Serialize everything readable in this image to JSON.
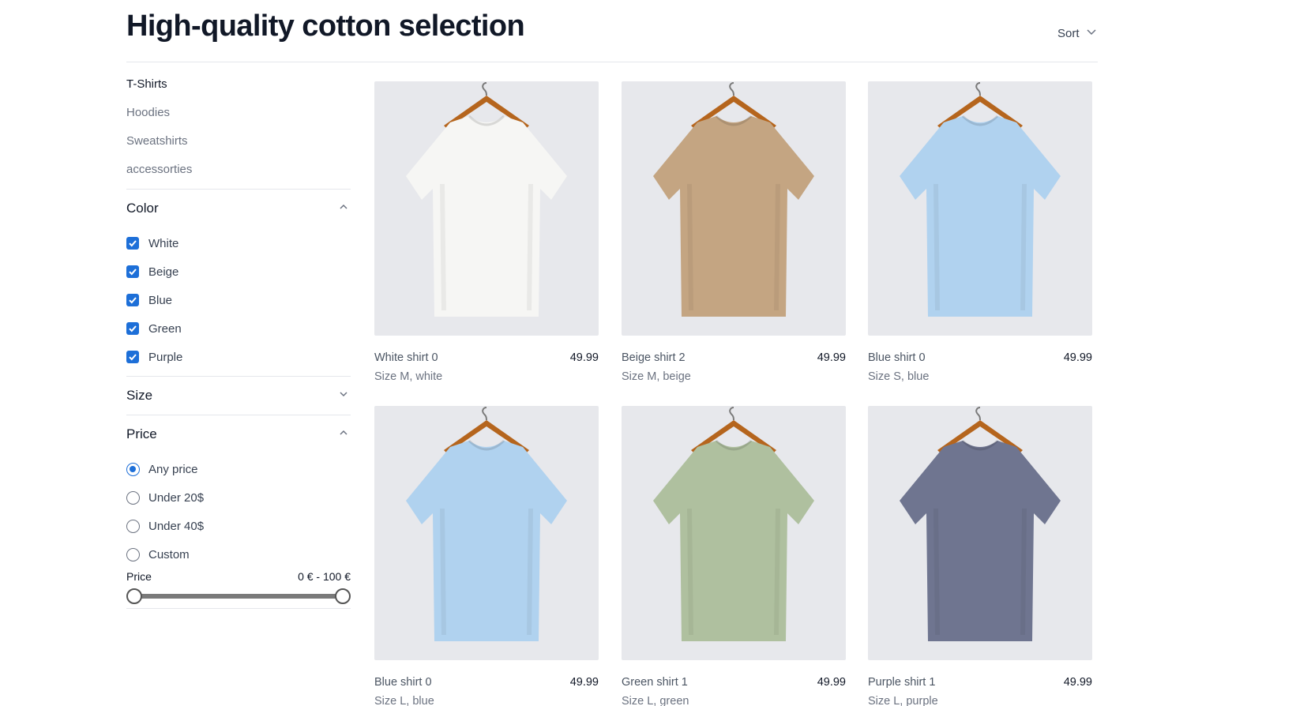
{
  "header": {
    "title": "High-quality cotton selection",
    "sort_label": "Sort"
  },
  "sidebar": {
    "categories": [
      {
        "label": "T-Shirts"
      },
      {
        "label": "Hoodies"
      },
      {
        "label": "Sweatshirts"
      },
      {
        "label": "accessorties"
      }
    ],
    "color_filter": {
      "title": "Color",
      "options": [
        {
          "label": "White",
          "checked": true
        },
        {
          "label": "Beige",
          "checked": true
        },
        {
          "label": "Blue",
          "checked": true
        },
        {
          "label": "Green",
          "checked": true
        },
        {
          "label": "Purple",
          "checked": true
        }
      ]
    },
    "size_filter": {
      "title": "Size"
    },
    "price_filter": {
      "title": "Price",
      "options": [
        {
          "label": "Any price",
          "selected": true
        },
        {
          "label": "Under 20$",
          "selected": false
        },
        {
          "label": "Under 40$",
          "selected": false
        },
        {
          "label": "Custom",
          "selected": false
        }
      ],
      "range_label": "Price",
      "range_value": "0 € - 100 €",
      "range_min": 0,
      "range_max": 100
    }
  },
  "products": [
    {
      "name": "White shirt 0",
      "price": "49.99",
      "meta": "Size M, white",
      "color": "#f6f6f4"
    },
    {
      "name": "Beige shirt 2",
      "price": "49.99",
      "meta": "Size M, beige",
      "color": "#c4a582"
    },
    {
      "name": "Blue shirt 0",
      "price": "49.99",
      "meta": "Size S, blue",
      "color": "#b0d2ef"
    },
    {
      "name": "Blue shirt 0",
      "price": "49.99",
      "meta": "Size L, blue",
      "color": "#b0d2ef"
    },
    {
      "name": "Green shirt 1",
      "price": "49.99",
      "meta": "Size L, green",
      "color": "#afc09f"
    },
    {
      "name": "Purple shirt 1",
      "price": "49.99",
      "meta": "Size L, purple",
      "color": "#6f7590"
    }
  ],
  "theme": {
    "accent": "#1d6fd8",
    "hanger": "#b5651d",
    "card_bg": "#e7e8ec"
  }
}
